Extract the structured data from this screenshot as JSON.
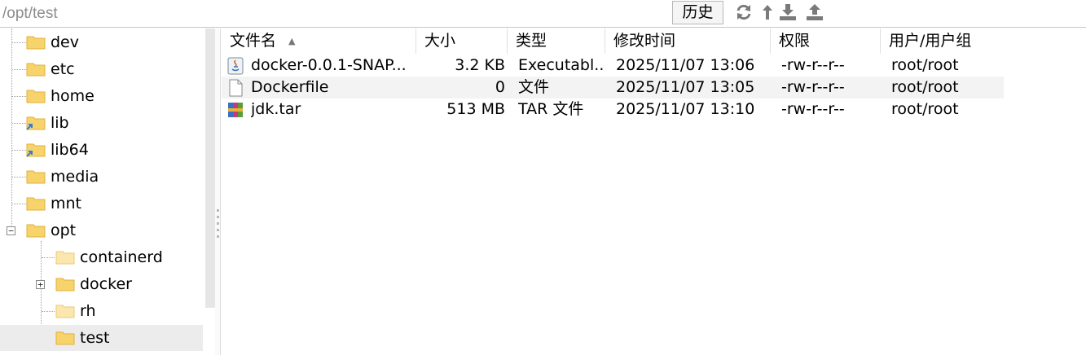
{
  "toolbar": {
    "path": "/opt/test",
    "history_label": "历史",
    "icons": [
      "refresh-icon",
      "up-arrow-icon",
      "download-icon",
      "upload-icon"
    ]
  },
  "tree": {
    "items": [
      {
        "label": "dev"
      },
      {
        "label": "etc"
      },
      {
        "label": "home"
      },
      {
        "label": "lib"
      },
      {
        "label": "lib64"
      },
      {
        "label": "media"
      },
      {
        "label": "mnt"
      },
      {
        "label": "opt"
      },
      {
        "label": "containerd"
      },
      {
        "label": "docker"
      },
      {
        "label": "rh"
      },
      {
        "label": "test"
      }
    ]
  },
  "files": {
    "columns": [
      "文件名",
      "大小",
      "类型",
      "修改时间",
      "权限",
      "用户/用户组"
    ],
    "rows": [
      {
        "name": "docker-0.0.1-SNAP...",
        "size": "3.2 KB",
        "type": "Executabl...",
        "modified": "2025/11/07 13:06",
        "perm": "-rw-r--r--",
        "owner": "root/root",
        "icon": "java-jar-icon"
      },
      {
        "name": "Dockerfile",
        "size": "0",
        "type": "文件",
        "modified": "2025/11/07 13:05",
        "perm": "-rw-r--r--",
        "owner": "root/root",
        "icon": "blank-file-icon"
      },
      {
        "name": "jdk.tar",
        "size": "513 MB",
        "type": "TAR 文件",
        "modified": "2025/11/07 13:10",
        "perm": "-rw-r--r--",
        "owner": "root/root",
        "icon": "archive-icon"
      }
    ]
  },
  "colors": {
    "folder": "#f7d36b",
    "folder_dark": "#e2b23c",
    "selected_row": "#ececec",
    "toolbar_icon": "#7a7a7a"
  }
}
